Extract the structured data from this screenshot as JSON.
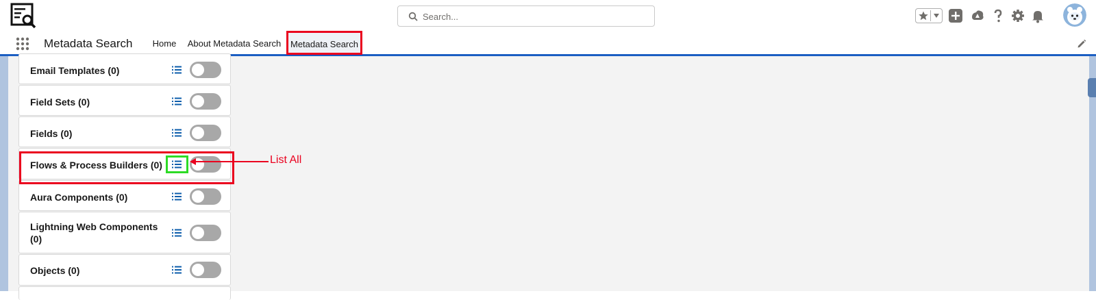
{
  "header": {
    "search_placeholder": "Search...",
    "icons": [
      "logo-icon",
      "search-icon",
      "favorites-star-icon",
      "favorites-caret-icon",
      "global-actions-icon",
      "trailhead-icon",
      "help-icon",
      "setup-gear-icon",
      "notifications-bell-icon",
      "avatar"
    ]
  },
  "nav": {
    "app_name": "Metadata Search",
    "tabs": [
      {
        "label": "Home"
      },
      {
        "label": "About Metadata Search"
      },
      {
        "label": "Metadata Search",
        "active": true
      }
    ]
  },
  "cards": [
    {
      "label": "Email Templates (0)",
      "enabled": false
    },
    {
      "label": "Field Sets (0)",
      "enabled": false
    },
    {
      "label": "Fields (0)",
      "enabled": false
    },
    {
      "label": "Flows & Process Builders (0)",
      "enabled": false,
      "highlighted": true
    },
    {
      "label": "Aura Components (0)",
      "enabled": false
    },
    {
      "label_line1": "Lightning Web Components",
      "label_line2": "(0)",
      "enabled": false
    },
    {
      "label": "Objects (0)",
      "enabled": false
    }
  ],
  "annotation": {
    "text": "List All",
    "color": "#ea001e",
    "highlight_color": "#2ddb25"
  },
  "colors": {
    "brand_blue": "#1b5ec2",
    "list_icon_blue": "#0b5cab",
    "toggle_off": "#a8a8a8"
  }
}
